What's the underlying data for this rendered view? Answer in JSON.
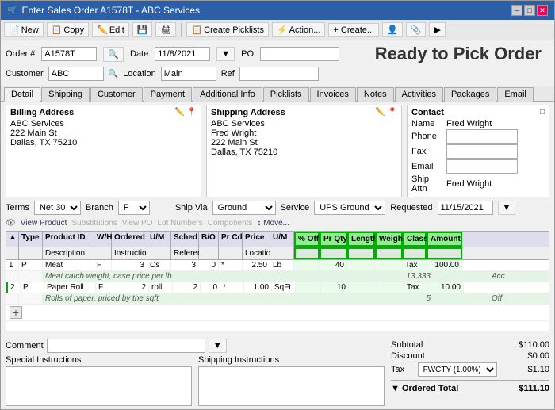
{
  "window": {
    "title": "Enter Sales Order A1578T - ABC Services",
    "controls": [
      "─",
      "□",
      "✕"
    ]
  },
  "toolbar": {
    "buttons": [
      {
        "label": "New",
        "icon": "📄"
      },
      {
        "label": "Copy",
        "icon": "📋"
      },
      {
        "label": "Edit",
        "icon": "✏️"
      },
      {
        "label": "💾",
        "icon": ""
      },
      {
        "label": "🖨",
        "icon": ""
      },
      {
        "label": "Create Picklists",
        "icon": "📋"
      },
      {
        "label": "Action...",
        "icon": "⚡"
      },
      {
        "label": "+ Create...",
        "icon": ""
      },
      {
        "label": "👤",
        "icon": ""
      },
      {
        "label": "📎",
        "icon": ""
      },
      {
        "label": "▶",
        "icon": ""
      }
    ]
  },
  "form": {
    "order_label": "Order #",
    "order_value": "A1578T",
    "date_label": "Date",
    "date_value": "11/8/2021",
    "po_label": "PO",
    "po_value": "",
    "customer_label": "Customer",
    "customer_value": "ABC",
    "location_label": "Location",
    "location_value": "Main",
    "ref_label": "Ref",
    "ref_value": "",
    "ready_to_pick": "Ready to Pick Order"
  },
  "tabs": [
    "Detail",
    "Shipping",
    "Customer",
    "Payment",
    "Additional Info",
    "Picklists",
    "Invoices",
    "Notes",
    "Activities",
    "Packages",
    "Email"
  ],
  "active_tab": "Detail",
  "billing": {
    "title": "Billing Address",
    "lines": [
      "ABC Services",
      "222 Main St",
      "Dallas, TX 75210"
    ]
  },
  "shipping": {
    "title": "Shipping Address",
    "lines": [
      "ABC Services",
      "Fred Wright",
      "222 Main St",
      "Dallas, TX 75210"
    ]
  },
  "contact": {
    "title": "Contact",
    "name_label": "Name",
    "name_value": "Fred Wright",
    "phone_label": "Phone",
    "phone_value": "",
    "fax_label": "Fax",
    "fax_value": "",
    "email_label": "Email",
    "email_value": "",
    "ship_attn_label": "Ship Attn",
    "ship_attn_value": "Fred Wright"
  },
  "terms": {
    "terms_label": "Terms",
    "terms_value": "Net 30",
    "branch_label": "Branch",
    "branch_value": "F",
    "ship_via_label": "Ship Via",
    "ship_via_value": "Ground",
    "service_label": "Service",
    "service_value": "UPS Ground",
    "requested_label": "Requested",
    "requested_value": "11/15/2021"
  },
  "grid_tools": [
    {
      "label": "View Product",
      "icon": "👁",
      "enabled": true
    },
    {
      "label": "Substitutions",
      "icon": "🔄",
      "enabled": false
    },
    {
      "label": "View PO",
      "icon": "📄",
      "enabled": false
    },
    {
      "label": "Lot Numbers",
      "icon": "🔢",
      "enabled": false
    },
    {
      "label": "Components",
      "icon": "⚙",
      "enabled": false
    },
    {
      "label": "Move...",
      "icon": "↕",
      "enabled": true
    }
  ],
  "grid": {
    "columns": [
      {
        "label": "▲",
        "class": "w-sort"
      },
      {
        "label": "Type",
        "class": "w-type"
      },
      {
        "label": "Product ID",
        "class": "w-prodid"
      },
      {
        "label": "W/H",
        "class": "w-wh"
      },
      {
        "label": "Ordered",
        "class": "w-ordered"
      },
      {
        "label": "U/M",
        "class": "w-um"
      },
      {
        "label": "Sched",
        "class": "w-sched"
      },
      {
        "label": "B/O",
        "class": "w-bo"
      },
      {
        "label": "Pr Cd",
        "class": "w-prcd"
      },
      {
        "label": "Price",
        "class": "w-price"
      },
      {
        "label": "U/M",
        "class": "w-um2"
      },
      {
        "label": "% Off",
        "class": "w-poff",
        "highlight": true
      },
      {
        "label": "Pr Qty",
        "class": "w-prqty",
        "highlight": true
      },
      {
        "label": "Length",
        "class": "w-len",
        "highlight": true
      },
      {
        "label": "Weight",
        "class": "w-wgt",
        "highlight": true
      },
      {
        "label": "Class",
        "class": "w-cls",
        "highlight": true
      },
      {
        "label": "Amount",
        "class": "w-amt",
        "highlight": true
      }
    ],
    "subheader": [
      "",
      "Description",
      "",
      "",
      "Instructions",
      "",
      "Reference",
      "",
      "",
      "Location",
      "",
      "",
      "",
      "",
      "",
      "",
      ""
    ],
    "rows": [
      {
        "type": "data",
        "cells": [
          "1",
          "P",
          "Meat",
          "F",
          "3",
          "Cs",
          "3",
          "0",
          "*",
          "2.50",
          "Lb",
          "",
          "40",
          "",
          "",
          "Tax",
          "100.00"
        ],
        "subtext": "Meat catch weight, case price per lb",
        "extra_cells": [
          "",
          "",
          "",
          "",
          "",
          "",
          "",
          "",
          "",
          "",
          "",
          "",
          "13.333",
          "",
          "",
          "Acc",
          ""
        ]
      },
      {
        "type": "data",
        "cells": [
          "2",
          "P",
          "Paper Roll",
          "F",
          "2",
          "roll",
          "2",
          "0",
          "*",
          "1.00",
          "SqFt",
          "",
          "10",
          "",
          "",
          "Tax",
          "10.00"
        ],
        "subtext": "Rolls of paper, priced by the sqft",
        "extra_cells": [
          "",
          "",
          "",
          "",
          "",
          "",
          "",
          "",
          "",
          "",
          "",
          "",
          "5",
          "",
          "",
          "Off",
          ""
        ]
      }
    ]
  },
  "bottom": {
    "comment_label": "Comment",
    "comment_value": "",
    "special_instructions_label": "Special Instructions",
    "shipping_instructions_label": "Shipping Instructions"
  },
  "totals": {
    "subtotal_label": "Subtotal",
    "subtotal_value": "$110.00",
    "discount_label": "Discount",
    "discount_value": "$0.00",
    "tax_label": "Tax",
    "tax_select": "FWCTY (1.00%)",
    "tax_value": "$1.10",
    "ordered_label": "▼ Ordered Total",
    "ordered_value": "$111.10"
  }
}
